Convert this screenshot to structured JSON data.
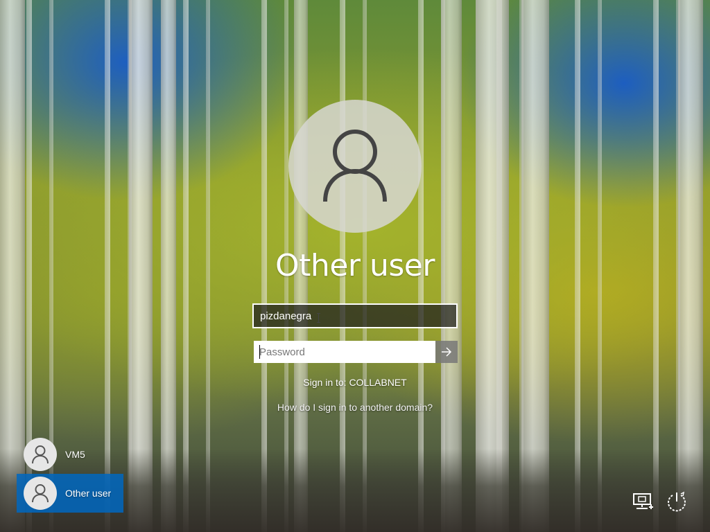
{
  "background": {
    "name": "aspen-forest-wallpaper"
  },
  "selected_user": {
    "display_name": "Other user",
    "avatar_icon": "person-icon"
  },
  "form": {
    "username_value": "pizdanegra",
    "password_placeholder": "Password",
    "submit_icon": "arrow-right-icon",
    "sign_in_to": "Sign in to: COLLABNET",
    "other_domain_link": "How do I sign in to another domain?"
  },
  "user_list": [
    {
      "label": "VM5",
      "icon": "person-icon",
      "selected": false
    },
    {
      "label": "Other user",
      "icon": "person-icon",
      "selected": true
    }
  ],
  "corner_buttons": {
    "network_icon": "network-icon",
    "power_icon": "power-icon"
  },
  "colors": {
    "selection_accent": "#0067c0",
    "field_border": "#ffffff",
    "submit_button": "#787878"
  }
}
